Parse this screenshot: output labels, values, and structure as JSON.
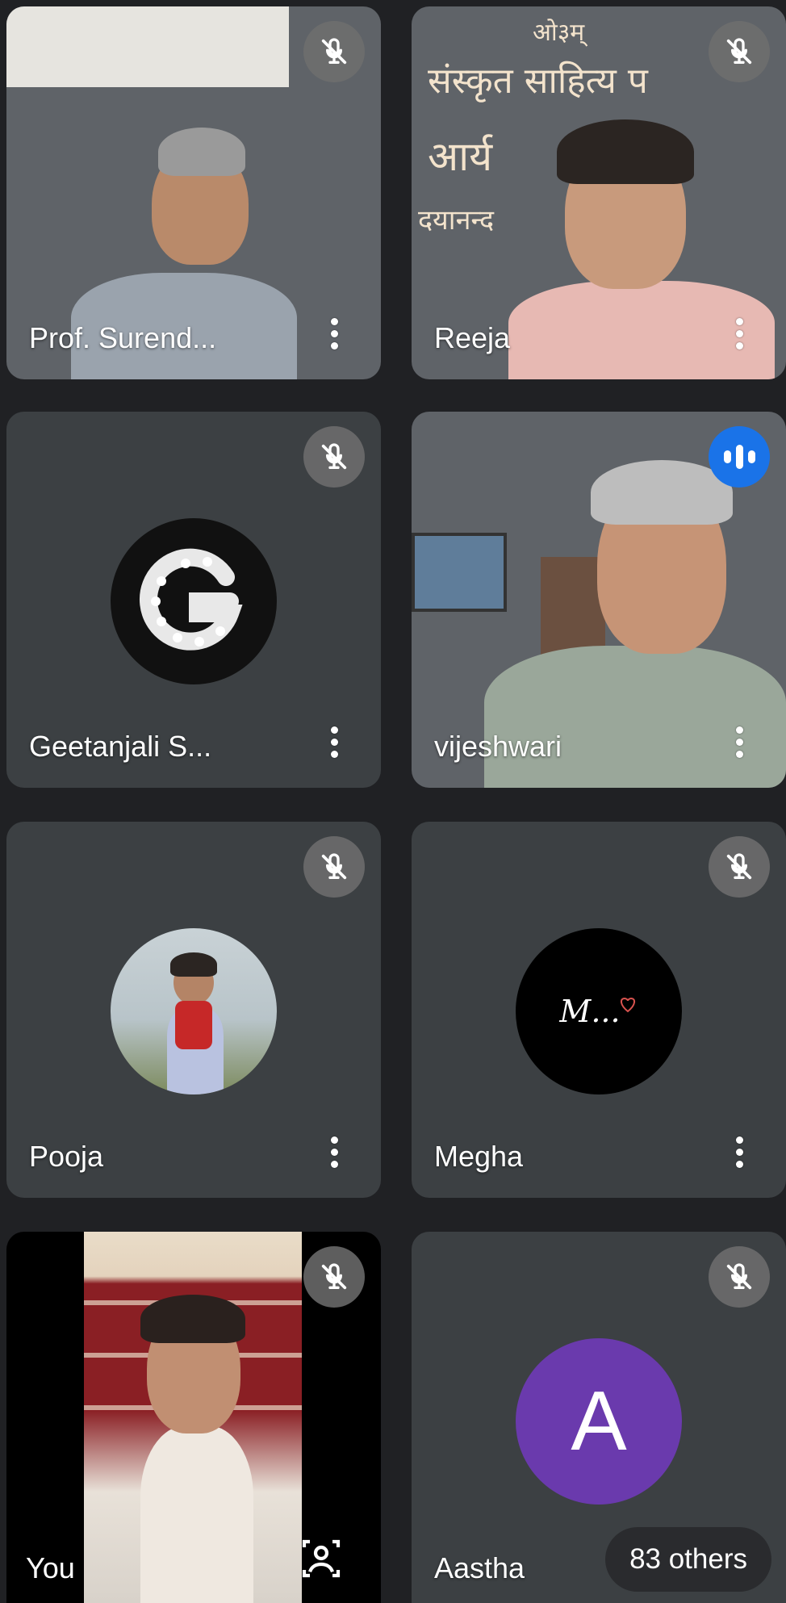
{
  "participants": [
    {
      "name": "Prof. Surend...",
      "muted": true,
      "tile": "video"
    },
    {
      "name": "Reeja",
      "muted": true,
      "tile": "video"
    },
    {
      "name": "Geetanjali S...",
      "muted": true,
      "tile": "avatar",
      "avatar_letter": "G"
    },
    {
      "name": "vijeshwari",
      "muted": false,
      "speaking": true,
      "tile": "video"
    },
    {
      "name": "Pooja",
      "muted": true,
      "tile": "avatar-photo"
    },
    {
      "name": "Megha",
      "muted": true,
      "tile": "avatar",
      "avatar_text": "M..."
    },
    {
      "name": "You",
      "muted": true,
      "tile": "self-video"
    },
    {
      "name": "Aastha",
      "muted": true,
      "tile": "avatar",
      "avatar_letter": "A"
    }
  ],
  "others_label": "83 others",
  "banner": {
    "line1": "ओ३म्",
    "line2": "संस्कृत साहित्य प",
    "line3": "आर्य",
    "line4": "दयानन्द"
  },
  "colors": {
    "background": "#202124",
    "tile": "#3c4043",
    "speaking": "#1a73e8",
    "avatar_a": "#6a3aad"
  },
  "icons": {
    "mute": "mic-off-icon",
    "more": "more-vert-icon",
    "speaking": "audio-level-icon",
    "self_cam": "camera-switch-icon"
  }
}
